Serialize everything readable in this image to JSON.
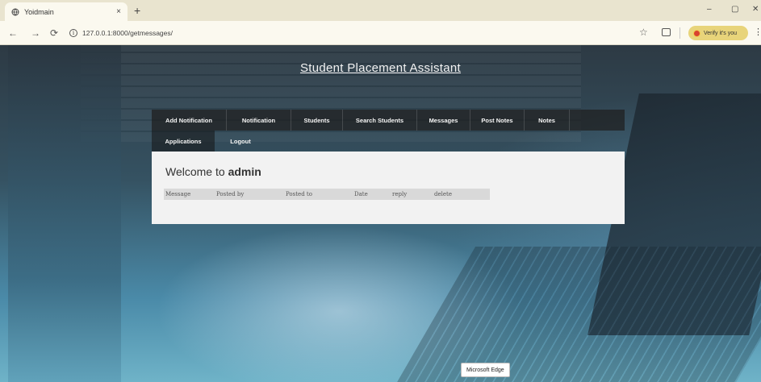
{
  "browser": {
    "tab_title": "Yoidmain",
    "tab_close": "×",
    "new_tab": "+",
    "url": "127.0.0.1:8000/getmessages/",
    "verify_label": "Verify it's you",
    "window_minimize": "–",
    "window_maximize": "▢",
    "window_close": "✕"
  },
  "site": {
    "title": "Student Placement Assistant"
  },
  "nav": {
    "row1": [
      "Add Notification",
      "Notification",
      "Students",
      "Search Students",
      "Messages",
      "Post Notes",
      "Notes"
    ],
    "row2": [
      "Applications",
      "Logout"
    ]
  },
  "main": {
    "welcome_prefix": "Welcome to",
    "welcome_user": "admin",
    "columns": [
      "Message",
      "Posted by",
      "Posted to",
      "Date",
      "reply",
      "delete"
    ]
  },
  "toast": {
    "text": "Microsoft Edge"
  },
  "icons": {
    "tab_favicon": "globe-icon",
    "back": "back-arrow-icon",
    "forward": "forward-arrow-icon",
    "reload": "reload-icon",
    "site_info": "info-icon",
    "favorite": "star-icon",
    "split_screen": "split-screen-icon",
    "menu": "more-vertical-icon"
  },
  "colors": {
    "chrome_bg": "#e9e4cf",
    "address_bg": "#fbf9ef",
    "verify_bg": "#e8d47a",
    "nav_bg": "#1e1e1e",
    "panel_bg": "#f2f2f2"
  }
}
